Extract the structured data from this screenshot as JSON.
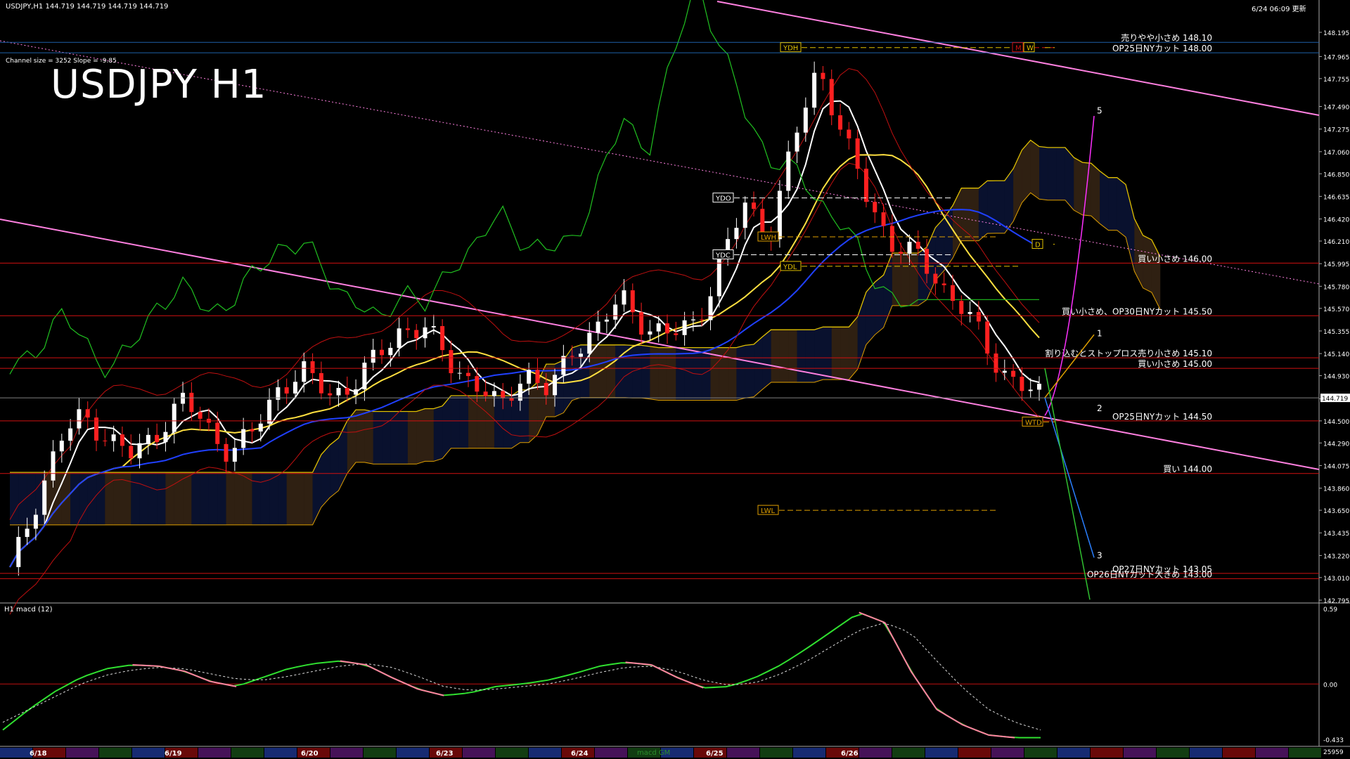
{
  "header": {
    "symbol_info": "USDJPY,H1  144.719 144.719 144.719 144.719",
    "updated": "6/24 06:09 更新",
    "channel_info": "Channel size = 3252 Slope = -9.85",
    "big_title": "USDJPY H1",
    "macd_label": "H1  macd (12)",
    "macd_footer_tag": "macd GM"
  },
  "chart_data": [
    {
      "type": "candlestick",
      "title": "USDJPY H1",
      "ylim": [
        142.795,
        148.195
      ],
      "y_ticks": [
        "148.195",
        "147.965",
        "147.755",
        "147.490",
        "147.275",
        "147.060",
        "146.850",
        "146.635",
        "146.420",
        "146.210",
        "145.995",
        "145.780",
        "145.570",
        "145.355",
        "145.140",
        "144.930",
        "144.710",
        "144.500",
        "144.290",
        "144.075",
        "143.860",
        "143.650",
        "143.435",
        "143.220",
        "143.010",
        "142.795"
      ],
      "current_price": "144.719",
      "x_labels": [
        "6/18",
        "6/19",
        "6/20",
        "6/23",
        "6/24",
        "6/25",
        "6/26"
      ],
      "close_path": [
        143.05,
        143.7,
        144.3,
        144.55,
        144.35,
        144.15,
        144.4,
        144.7,
        144.45,
        144.2,
        144.4,
        144.85,
        144.95,
        144.75,
        144.85,
        145.1,
        145.4,
        145.35,
        145.05,
        144.85,
        144.6,
        145.0,
        144.75,
        145.2,
        145.4,
        145.65,
        145.4,
        145.3,
        145.45,
        146.0,
        146.55,
        146.3,
        147.15,
        147.9,
        147.2,
        146.6,
        146.2,
        146.05,
        145.8,
        145.55,
        145.1,
        144.9,
        144.72
      ],
      "horizontal_levels": [
        {
          "price": 148.1,
          "label": "売りやや小さめ 148.10",
          "color": "#1e5fa8"
        },
        {
          "price": 148.0,
          "label": "OP25日NYカット 148.00",
          "color": "#1e5fa8"
        },
        {
          "price": 146.0,
          "label": "買い小さめ 146.00",
          "color": "#d01010"
        },
        {
          "price": 145.5,
          "label": "買い小さめ、OP30日NYカット 145.50",
          "color": "#d01010"
        },
        {
          "price": 145.1,
          "label": "割り込むとストップロス売り小さめ 145.10",
          "color": "#d01010"
        },
        {
          "price": 145.0,
          "label": "買い小さめ 145.00",
          "color": "#d01010"
        },
        {
          "price": 144.5,
          "label": "OP25日NYカット 144.50",
          "color": "#d01010"
        },
        {
          "price": 144.0,
          "label": "買い 144.00",
          "color": "#d01010"
        },
        {
          "price": 143.05,
          "label": "OP27日NYカット 143.05",
          "color": "#d01010"
        },
        {
          "price": 143.0,
          "label": "OP26日NYカット大きめ 143.00",
          "color": "#d01010"
        }
      ],
      "tags": [
        {
          "label": "YDH",
          "price": 148.05,
          "color": "#e0c000"
        },
        {
          "label": "YDO",
          "price": 146.62,
          "color": "#ffffff"
        },
        {
          "label": "LWH",
          "price": 146.25,
          "color": "#e0a000"
        },
        {
          "label": "YDC",
          "price": 146.08,
          "color": "#ffffff"
        },
        {
          "label": "YDL",
          "price": 145.97,
          "color": "#e0c000"
        },
        {
          "label": "LWL",
          "price": 143.65,
          "color": "#e0a000"
        },
        {
          "label": "WTD",
          "price": 144.49,
          "color": "#e0a000"
        },
        {
          "label": "D",
          "price": 146.18,
          "color": "#e0c000"
        },
        {
          "label": "M",
          "price": 148.05,
          "color": "#d01010"
        },
        {
          "label": "W",
          "price": 148.05,
          "color": "#e0c000"
        }
      ],
      "wave_labels": [
        {
          "label": "5",
          "price": 147.45
        },
        {
          "label": "1",
          "price": 145.33
        },
        {
          "label": "2",
          "price": 144.62
        },
        {
          "label": "3",
          "price": 143.22
        }
      ]
    },
    {
      "type": "line",
      "title": "H1  macd (12)",
      "ylim": [
        -0.433,
        0.59
      ],
      "y_ticks": [
        "0.59",
        "0.00",
        "-0.433"
      ],
      "footer_value": "25959",
      "macd_path": [
        -0.36,
        -0.2,
        -0.06,
        0.05,
        0.12,
        0.15,
        0.14,
        0.1,
        0.02,
        -0.02,
        0.05,
        0.12,
        0.16,
        0.18,
        0.15,
        0.05,
        -0.04,
        -0.09,
        -0.07,
        -0.02,
        0.0,
        0.03,
        0.08,
        0.14,
        0.17,
        0.15,
        0.05,
        -0.03,
        -0.02,
        0.05,
        0.15,
        0.28,
        0.42,
        0.56,
        0.48,
        0.1,
        -0.2,
        -0.32,
        -0.4,
        -0.42,
        -0.42
      ],
      "signal_path": [
        -0.3,
        -0.2,
        -0.1,
        0.0,
        0.07,
        0.11,
        0.13,
        0.12,
        0.08,
        0.04,
        0.03,
        0.06,
        0.1,
        0.14,
        0.16,
        0.13,
        0.06,
        -0.02,
        -0.05,
        -0.04,
        -0.02,
        0.0,
        0.04,
        0.09,
        0.13,
        0.14,
        0.1,
        0.03,
        -0.01,
        0.01,
        0.08,
        0.18,
        0.3,
        0.42,
        0.48,
        0.4,
        0.18,
        -0.03,
        -0.2,
        -0.3,
        -0.36
      ]
    }
  ]
}
